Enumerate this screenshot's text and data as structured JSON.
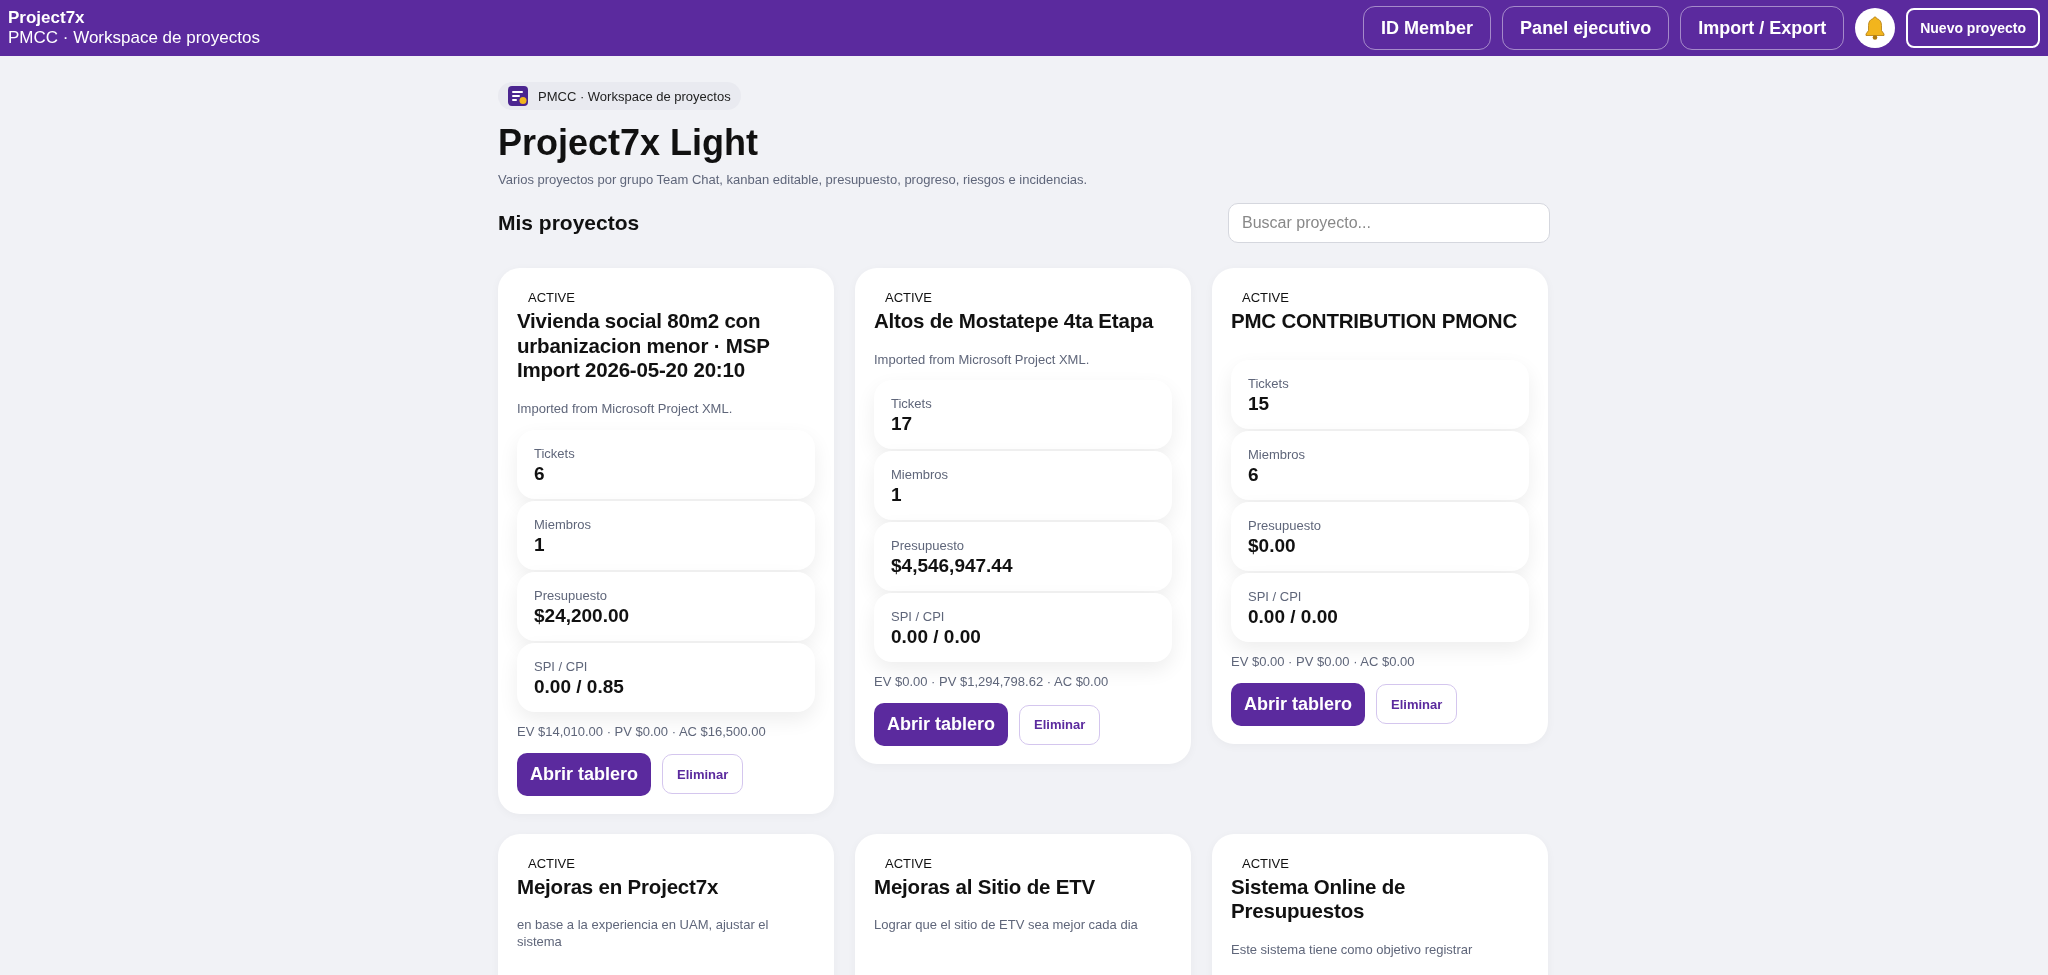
{
  "topbar": {
    "brand": "Project7x",
    "subtitle": "PMCC · Workspace de proyectos",
    "buttons": [
      {
        "label": "ID Member",
        "kind": "outline"
      },
      {
        "label": "Panel ejecutivo",
        "kind": "outline"
      },
      {
        "label": "Import / Export",
        "kind": "outline"
      },
      {
        "kind": "bell"
      },
      {
        "label": "Nuevo proyecto",
        "kind": "primary"
      }
    ]
  },
  "breadcrumb": "PMCC · Workspace de proyectos",
  "title": "Project7x Light",
  "description": "Varios proyectos por grupo Team Chat, kanban editable, presupuesto, progreso, riesgos e incidencias.",
  "section_title": "Mis proyectos",
  "search": {
    "placeholder": "Buscar proyecto..."
  },
  "projects": [
    {
      "status": "ACTIVE",
      "name": "Vivienda social 80m2 con urbanizacion menor · MSP Import 2026-05-20 20:10",
      "description": "Imported from Microsoft Project XML.",
      "stats": [
        {
          "label": "Tickets",
          "value": "6"
        },
        {
          "label": "Miembros",
          "value": "1"
        },
        {
          "label": "Presupuesto",
          "value": "$24,200.00"
        },
        {
          "label": "SPI / CPI",
          "value": "0.00 / 0.85"
        }
      ],
      "evm": "EV $14,010.00 · PV $0.00 · AC $16,500.00",
      "actions": [
        "Abrir tablero",
        "Eliminar"
      ]
    },
    {
      "status": "ACTIVE",
      "name": "Altos de Mostatepe 4ta Etapa",
      "description": "Imported from Microsoft Project XML.",
      "stats": [
        {
          "label": "Tickets",
          "value": "17"
        },
        {
          "label": "Miembros",
          "value": "1"
        },
        {
          "label": "Presupuesto",
          "value": "$4,546,947.44"
        },
        {
          "label": "SPI / CPI",
          "value": "0.00 / 0.00"
        }
      ],
      "evm": "EV $0.00 · PV $1,294,798.62 · AC $0.00",
      "actions": [
        "Abrir tablero",
        "Eliminar"
      ]
    },
    {
      "status": "ACTIVE",
      "name": "PMC CONTRIBUTION PMONC",
      "stats": [
        {
          "label": "Tickets",
          "value": "15"
        },
        {
          "label": "Miembros",
          "value": "6"
        },
        {
          "label": "Presupuesto",
          "value": "$0.00"
        },
        {
          "label": "SPI / CPI",
          "value": "0.00 / 0.00"
        }
      ],
      "evm": "EV $0.00 · PV $0.00 · AC $0.00",
      "actions": [
        "Abrir tablero",
        "Eliminar"
      ]
    },
    {
      "status": "ACTIVE",
      "name": "Mejoras en Project7x",
      "description": "en base a la experiencia en UAM, ajustar el sistema"
    },
    {
      "status": "ACTIVE",
      "name": "Mejoras al Sitio de ETV",
      "description": "Lograr que el sitio de ETV sea mejor cada dia"
    },
    {
      "status": "ACTIVE",
      "name": "Sistema Online de Presupuestos",
      "description": "Este sistema tiene como objetivo registrar"
    }
  ]
}
